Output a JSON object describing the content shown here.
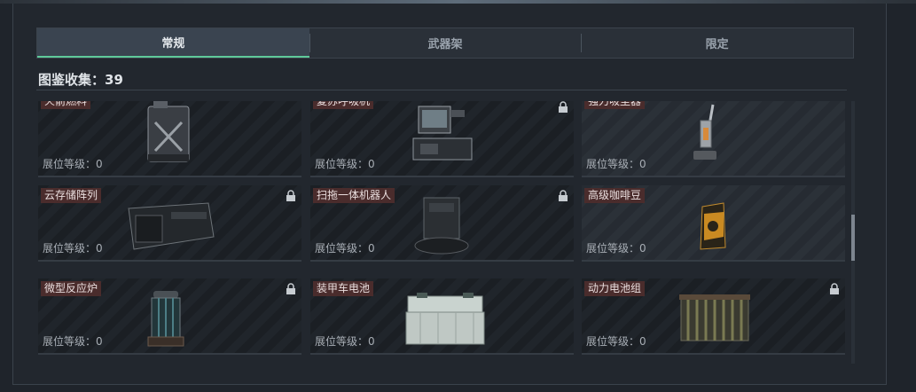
{
  "tabs": [
    "常规",
    "武器架",
    "限定"
  ],
  "active_tab": 0,
  "collection": {
    "label": "图鉴收集：",
    "count": "39"
  },
  "level_label": "展位等级：",
  "items": [
    {
      "name": "火箭燃料",
      "level": "0",
      "locked": false,
      "icon": "fuel-can-icon"
    },
    {
      "name": "复苏呼吸机",
      "level": "0",
      "locked": true,
      "icon": "ventilator-icon"
    },
    {
      "name": "强力吸尘器",
      "level": "0",
      "locked": false,
      "icon": "vacuum-icon"
    },
    {
      "name": "云存储阵列",
      "level": "0",
      "locked": true,
      "icon": "storage-array-icon"
    },
    {
      "name": "扫拖一体机器人",
      "level": "0",
      "locked": true,
      "icon": "robot-cleaner-icon"
    },
    {
      "name": "高级咖啡豆",
      "level": "0",
      "locked": false,
      "icon": "coffee-bag-icon"
    },
    {
      "name": "微型反应炉",
      "level": "0",
      "locked": true,
      "icon": "reactor-icon"
    },
    {
      "name": "装甲车电池",
      "level": "0",
      "locked": false,
      "icon": "battery-icon"
    },
    {
      "name": "动力电池组",
      "level": "0",
      "locked": true,
      "icon": "battery-pack-icon"
    }
  ]
}
